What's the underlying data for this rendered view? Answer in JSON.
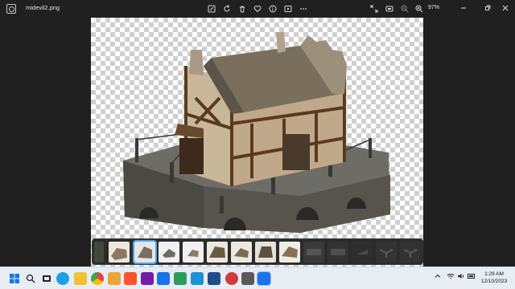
{
  "window": {
    "filename": "midevil2.png",
    "zoom": "97%",
    "toolbar_icons": [
      "edit-icon",
      "rotate-icon",
      "delete-icon",
      "favorite-icon",
      "info-icon",
      "slideshow-icon",
      "more-icon"
    ],
    "right_icons": [
      "expand-icon",
      "fit-icon",
      "zoom-out-icon",
      "zoom-in-icon"
    ],
    "controls": [
      "minimize-icon",
      "maximize-icon",
      "close-icon"
    ]
  },
  "filmstrip": {
    "selected_index": 1,
    "thumbnails": 13
  },
  "taskbar": {
    "apps": [
      "start-icon",
      "search-icon",
      "taskview-icon",
      "edge-icon",
      "explorer-icon",
      "chrome-icon",
      "brave-icon",
      "word-icon",
      "onenote-icon",
      "mail-icon",
      "vscode-icon",
      "maps-icon",
      "photos-icon",
      "terminal-icon",
      "app-icon",
      "app-icon",
      "settings-icon",
      "photos-app-icon"
    ],
    "clock_time": "1:29 AM",
    "clock_date": "12/10/2023"
  }
}
